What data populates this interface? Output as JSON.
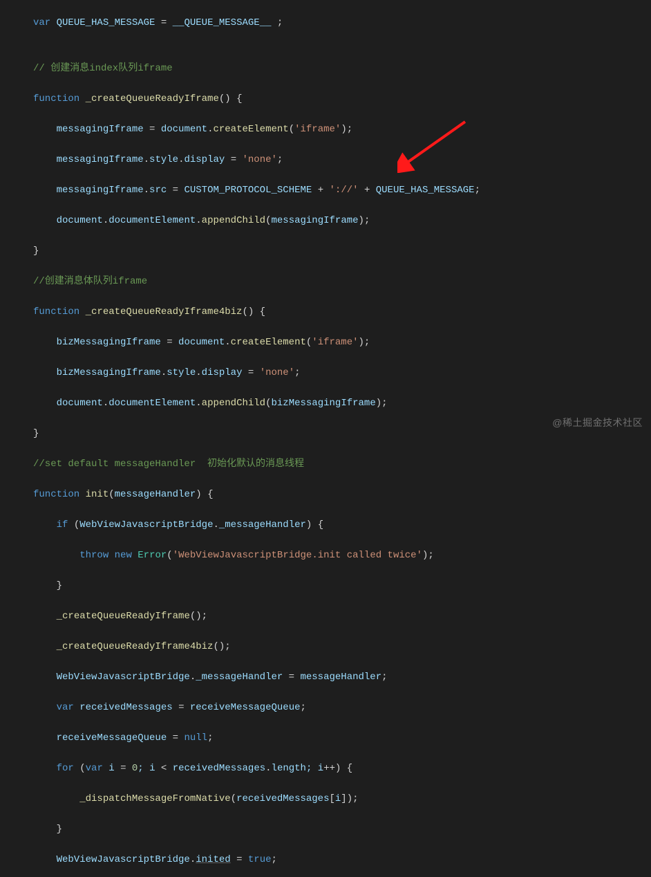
{
  "code": {
    "l1a": "var",
    "l1b": " QUEUE_HAS_MESSAGE ",
    "l1c": "=",
    "l1d": " __QUEUE_MESSAGE__ ",
    "l1e": ";",
    "blank": "",
    "l3": "// 创建消息index队列iframe",
    "l4a": "function",
    "l4b": " ",
    "l4c": "_createQueueReadyIframe",
    "l4d": "()",
    "l4e": " {",
    "l5a": "    messagingIframe ",
    "l5b": "=",
    "l5c": " document",
    "l5d": ".",
    "l5e": "createElement",
    "l5f": "(",
    "l5g": "'iframe'",
    "l5h": ")",
    "l5i": ";",
    "l6a": "    messagingIframe",
    "l6b": ".",
    "l6c": "style",
    "l6d": ".",
    "l6e": "display ",
    "l6f": "=",
    "l6g": " ",
    "l6h": "'none'",
    "l6i": ";",
    "l7a": "    messagingIframe",
    "l7b": ".",
    "l7c": "src ",
    "l7d": "=",
    "l7e": " CUSTOM_PROTOCOL_SCHEME ",
    "l7f": "+",
    "l7g": " ",
    "l7h": "'://'",
    "l7i": " ",
    "l7j": "+",
    "l7k": " QUEUE_HAS_MESSAGE",
    "l7l": ";",
    "l8a": "    document",
    "l8b": ".",
    "l8c": "documentElement",
    "l8d": ".",
    "l8e": "appendChild",
    "l8f": "(",
    "l8g": "messagingIframe",
    "l8h": ")",
    "l8i": ";",
    "l9": "}",
    "l10": "//创建消息体队列iframe",
    "l11a": "function",
    "l11b": " ",
    "l11c": "_createQueueReadyIframe4biz",
    "l11d": "()",
    "l11e": " {",
    "l12a": "    bizMessagingIframe ",
    "l12b": "=",
    "l12c": " document",
    "l12d": ".",
    "l12e": "createElement",
    "l12f": "(",
    "l12g": "'iframe'",
    "l12h": ")",
    "l12i": ";",
    "l13a": "    bizMessagingIframe",
    "l13b": ".",
    "l13c": "style",
    "l13d": ".",
    "l13e": "display ",
    "l13f": "=",
    "l13g": " ",
    "l13h": "'none'",
    "l13i": ";",
    "l14a": "    document",
    "l14b": ".",
    "l14c": "documentElement",
    "l14d": ".",
    "l14e": "appendChild",
    "l14f": "(",
    "l14g": "bizMessagingIframe",
    "l14h": ")",
    "l14i": ";",
    "l15": "}",
    "l16": "//set default messageHandler  初始化默认的消息线程",
    "l17a": "function",
    "l17b": " ",
    "l17c": "init",
    "l17d": "(",
    "l17e": "messageHandler",
    "l17f": ")",
    "l17g": " {",
    "l18a": "    ",
    "l18b": "if",
    "l18c": " (",
    "l18d": "WebViewJavascriptBridge",
    "l18e": ".",
    "l18f": "_messageHandler",
    "l18g": ")",
    "l18h": " {",
    "l19a": "        ",
    "l19b": "throw",
    "l19c": " ",
    "l19d": "new",
    "l19e": " ",
    "l19f": "Error",
    "l19g": "(",
    "l19h": "'WebViewJavascriptBridge.init called twice'",
    "l19i": ")",
    "l19j": ";",
    "l20": "    }",
    "l21a": "    ",
    "l21b": "_createQueueReadyIframe",
    "l21c": "()",
    "l21d": ";",
    "l22a": "    ",
    "l22b": "_createQueueReadyIframe4biz",
    "l22c": "()",
    "l22d": ";",
    "l23a": "    WebViewJavascriptBridge",
    "l23b": ".",
    "l23c": "_messageHandler ",
    "l23d": "=",
    "l23e": " messageHandler",
    "l23f": ";",
    "l24a": "    ",
    "l24b": "var",
    "l24c": " receivedMessages ",
    "l24d": "=",
    "l24e": " receiveMessageQueue",
    "l24f": ";",
    "l25a": "    receiveMessageQueue ",
    "l25b": "=",
    "l25c": " ",
    "l25d": "null",
    "l25e": ";",
    "l26a": "    ",
    "l26b": "for",
    "l26c": " (",
    "l26d": "var",
    "l26e": " i ",
    "l26f": "=",
    "l26g": " ",
    "l26h": "0",
    "l26i": "; i ",
    "l26j": "<",
    "l26k": " receivedMessages",
    "l26l": ".",
    "l26m": "length",
    "l26n": "; i",
    "l26o": "++",
    "l26p": ")",
    "l26q": " {",
    "l27a": "        ",
    "l27b": "_dispatchMessageFromNative",
    "l27c": "(",
    "l27d": "receivedMessages",
    "l27e": "[",
    "l27f": "i",
    "l27g": "]",
    "l27h": ")",
    "l27i": ";",
    "l28": "    }",
    "l29a": "    WebViewJavascriptBridge",
    "l29b": ".",
    "l29c": "inited",
    "l29d": " ",
    "l29e": "=",
    "l29f": " ",
    "l29g": "true",
    "l29h": ";"
  },
  "watermark": "@稀土掘金技术社区",
  "arrow_color": "#ff0000"
}
